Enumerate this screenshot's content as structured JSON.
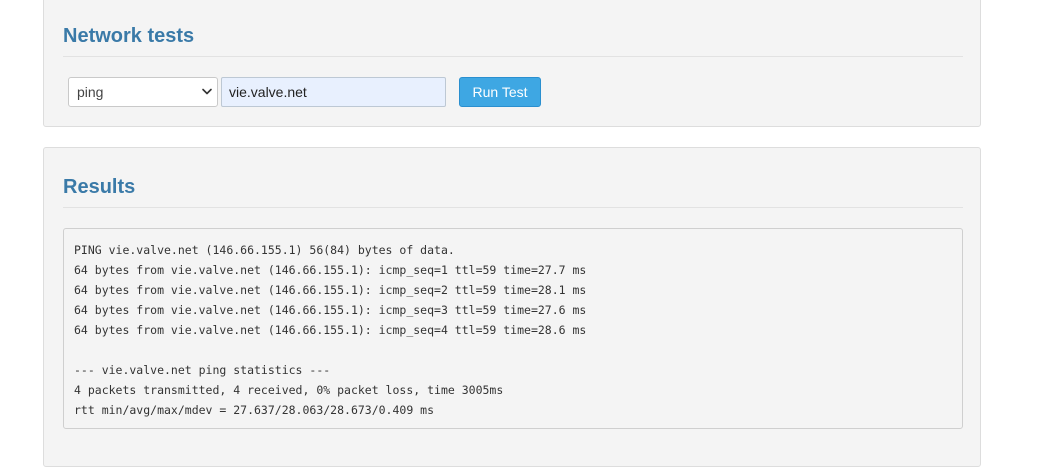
{
  "network_tests": {
    "title": "Network tests",
    "tool_select": {
      "selected": "ping"
    },
    "host_input": {
      "value": "vie.valve.net"
    },
    "run_button_label": "Run Test"
  },
  "results": {
    "title": "Results",
    "lines": [
      "PING vie.valve.net (146.66.155.1) 56(84) bytes of data.",
      "64 bytes from vie.valve.net (146.66.155.1): icmp_seq=1 ttl=59 time=27.7 ms",
      "64 bytes from vie.valve.net (146.66.155.1): icmp_seq=2 ttl=59 time=28.1 ms",
      "64 bytes from vie.valve.net (146.66.155.1): icmp_seq=3 ttl=59 time=27.6 ms",
      "64 bytes from vie.valve.net (146.66.155.1): icmp_seq=4 ttl=59 time=28.6 ms",
      "",
      "--- vie.valve.net ping statistics ---",
      "4 packets transmitted, 4 received, 0% packet loss, time 3005ms",
      "rtt min/avg/max/mdev = 27.637/28.063/28.673/0.409 ms"
    ]
  }
}
